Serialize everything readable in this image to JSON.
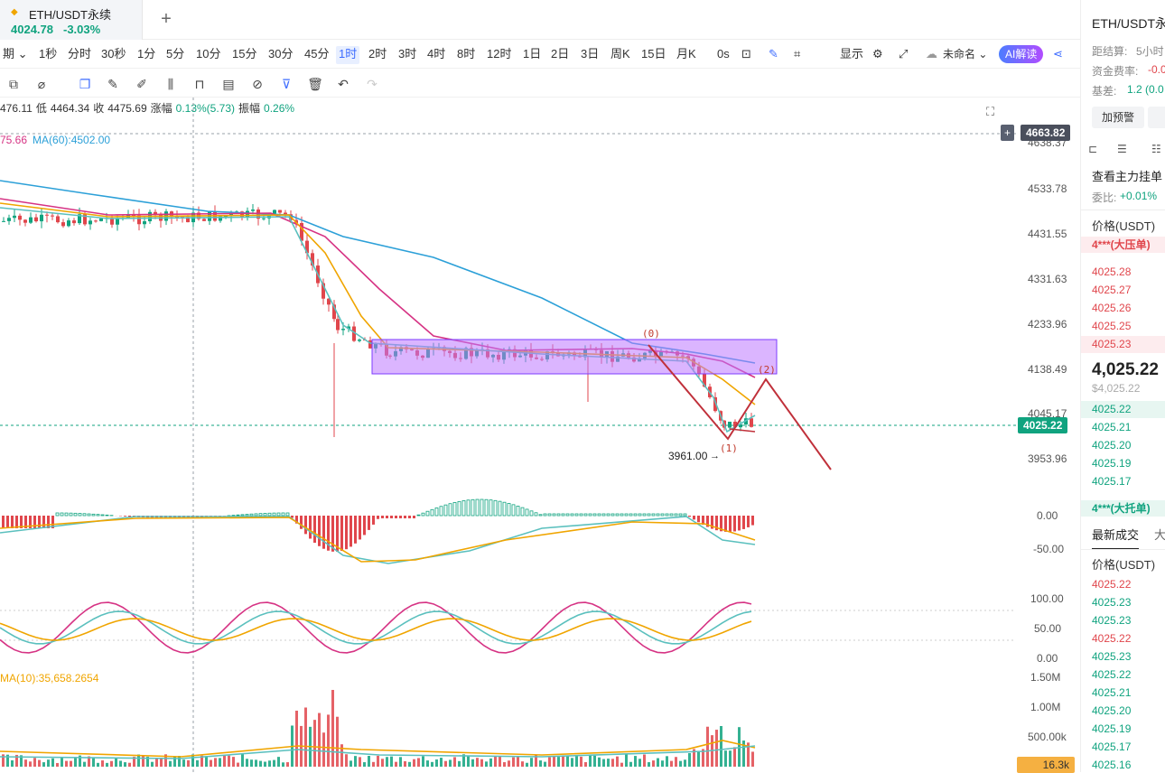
{
  "tab": {
    "symbol": "ETH/USDT永续",
    "price": "4024.78",
    "change": "-3.03%"
  },
  "intervals": {
    "items": [
      "期",
      "1秒",
      "分时",
      "30秒",
      "1分",
      "5分",
      "10分",
      "15分",
      "30分",
      "45分",
      "1时",
      "2时",
      "3时",
      "4时",
      "8时",
      "12时",
      "1日",
      "2日",
      "3日",
      "周K",
      "15日",
      "月K",
      "0s"
    ],
    "period_label": "期",
    "selected": "1时",
    "display_label": "显示",
    "layout_name": "未命名",
    "ai_button": "AI解读"
  },
  "ohlc": {
    "open": "476.11",
    "low_label": "低",
    "low": "4464.34",
    "close_label": "收",
    "close": "4475.69",
    "change_label": "涨幅",
    "change": "0.13%(5.73)",
    "amp_label": "振幅",
    "amp": "0.26%"
  },
  "ma": {
    "ma30": "75.66",
    "ma60_label": "MA(60):4502.00"
  },
  "volume_ma": "MA(10):35,658.2654",
  "price_axis": {
    "ticks": [
      "4638.37",
      "4533.78",
      "4431.55",
      "4331.63",
      "4233.96",
      "4138.49",
      "4045.17",
      "3953.96"
    ],
    "crosshair_price": "4663.82",
    "last_price": "4025.22"
  },
  "macd_axis": [
    "0.00",
    "-50.00"
  ],
  "kdj_axis": [
    "100.00",
    "50.00",
    "0.00"
  ],
  "vol_axis": [
    "1.50M",
    "1.00M",
    "500.00k"
  ],
  "vol_current": "16.3k",
  "annotations": {
    "low_label": "3961.00",
    "wave0": "(0)",
    "wave1": "(1)",
    "wave2": "(2)"
  },
  "sidebar": {
    "title": "ETH/USDT永",
    "settle_label": "距结算:",
    "settle_value": "5小时",
    "funding_label": "资金费率:",
    "funding_value": "-0.0",
    "basis_label": "基差:",
    "basis_value": "1.2 (0.0",
    "alert_button": "加预警",
    "orderbook_link": "查看主力挂单",
    "ratio_label": "委比:",
    "ratio_value": "+0.01%",
    "price_header": "价格(USDT)",
    "big_ask_label": "4***(大压单)",
    "asks": [
      "4025.28",
      "4025.27",
      "4025.26",
      "4025.25",
      "4025.23"
    ],
    "last_price": "4,025.22",
    "last_price_usd": "$4,025.22",
    "bids": [
      "4025.22",
      "4025.21",
      "4025.20",
      "4025.19",
      "4025.17"
    ],
    "big_bid_label": "4***(大托单)",
    "trades_tab": "最新成交",
    "trades_tab2": "大",
    "trades_header": "价格(USDT)",
    "trades": [
      {
        "price": "4025.22",
        "side": "sell"
      },
      {
        "price": "4025.23",
        "side": "buy"
      },
      {
        "price": "4025.23",
        "side": "buy"
      },
      {
        "price": "4025.22",
        "side": "sell"
      },
      {
        "price": "4025.23",
        "side": "buy"
      },
      {
        "price": "4025.22",
        "side": "buy"
      },
      {
        "price": "4025.21",
        "side": "buy"
      },
      {
        "price": "4025.20",
        "side": "buy"
      },
      {
        "price": "4025.19",
        "side": "buy"
      },
      {
        "price": "4025.17",
        "side": "buy"
      },
      {
        "price": "4025.16",
        "side": "buy"
      }
    ]
  },
  "colors": {
    "up": "#10a37f",
    "down": "#e0464c",
    "accent": "#3d6cff"
  }
}
